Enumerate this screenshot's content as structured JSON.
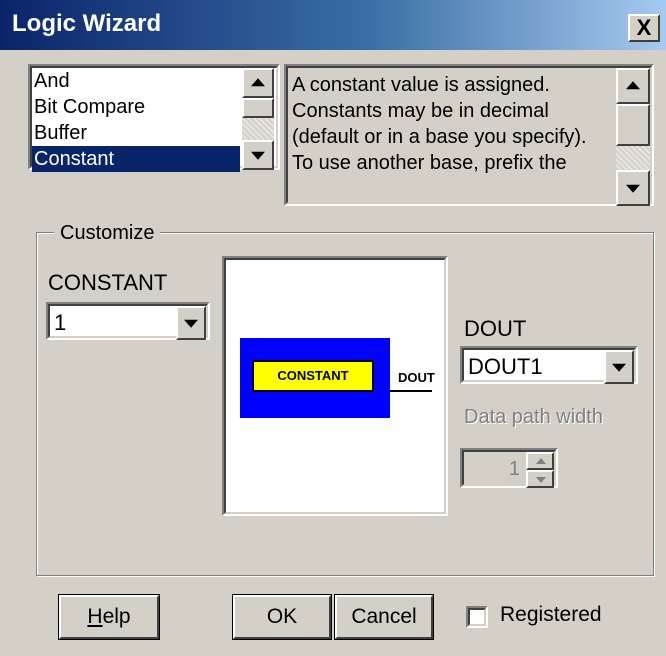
{
  "window": {
    "title": "Logic Wizard",
    "close_glyph": "X"
  },
  "function_list": {
    "items": [
      "And",
      "Bit Compare",
      "Buffer",
      "Constant"
    ],
    "selected_index": 3
  },
  "description": {
    "lines": [
      "A constant value is assigned.",
      "Constants may be in decimal",
      "(default or in a base you specify).",
      "To use another base, prefix the"
    ]
  },
  "customize": {
    "group_label": "Customize",
    "constant_label": "CONSTANT",
    "constant_value": "1",
    "diagram": {
      "block_label": "CONSTANT",
      "output_label": "DOUT",
      "block_color": "#0000ff",
      "inner_color": "#ffff00"
    },
    "dout_label": "DOUT",
    "dout_value": "DOUT1",
    "data_path_width_label": "Data path width",
    "data_path_width_value": "1"
  },
  "buttons": {
    "help_underlined": "H",
    "help_rest": "elp",
    "ok": "OK",
    "cancel": "Cancel"
  },
  "registered": {
    "label": "Registered",
    "checked": false
  },
  "icons": [
    "close-icon",
    "scroll-up-arrow-icon",
    "scroll-down-arrow-icon",
    "dropdown-arrow-icon",
    "spin-up-arrow-icon",
    "spin-down-arrow-icon"
  ]
}
